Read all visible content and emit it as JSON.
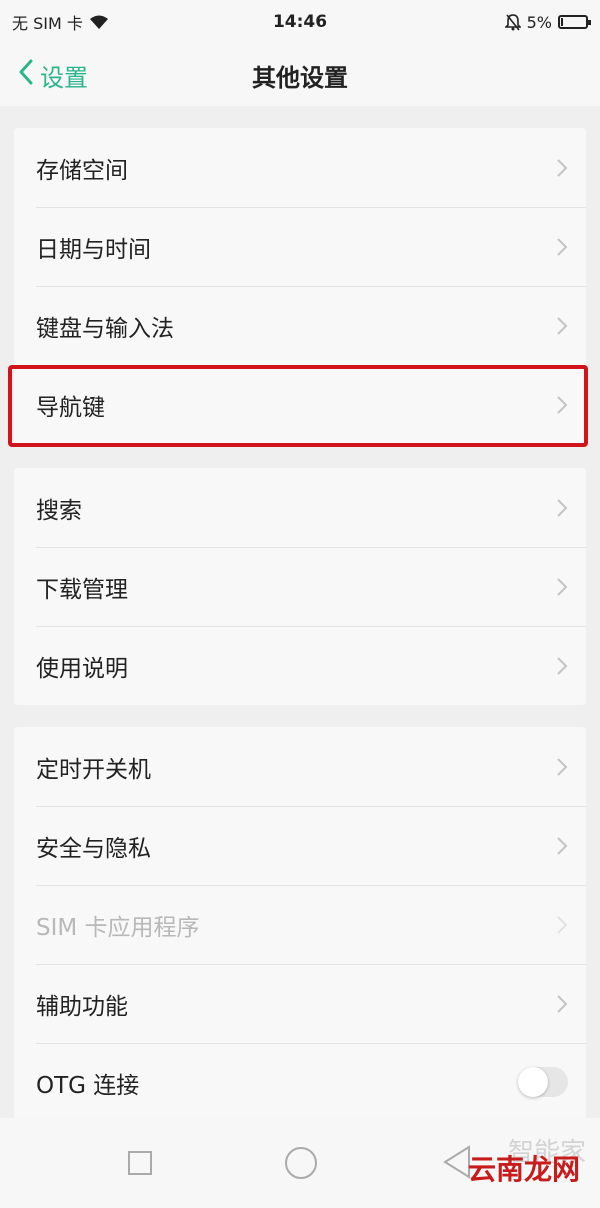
{
  "status_bar": {
    "carrier": "无 SIM 卡",
    "time": "14:46",
    "battery": "5%",
    "battery_level": 0.05
  },
  "header": {
    "back_label": "设置",
    "title": "其他设置"
  },
  "groups": [
    {
      "items": [
        {
          "label": "存储空间"
        },
        {
          "label": "日期与时间"
        },
        {
          "label": "键盘与输入法"
        },
        {
          "label": "导航键",
          "highlighted": true
        }
      ]
    },
    {
      "items": [
        {
          "label": "搜索"
        },
        {
          "label": "下载管理"
        },
        {
          "label": "使用说明"
        }
      ]
    },
    {
      "items": [
        {
          "label": "定时开关机"
        },
        {
          "label": "安全与隐私"
        },
        {
          "label": "SIM 卡应用程序",
          "disabled": true
        },
        {
          "label": "辅助功能"
        },
        {
          "label": "OTG 连接",
          "toggle": false
        }
      ]
    }
  ],
  "watermark": {
    "faint": "智能家",
    "brand": "云南龙网"
  },
  "colors": {
    "accent": "#2bb58a",
    "highlight": "#d0141a",
    "watermark": "#c81c1c"
  }
}
